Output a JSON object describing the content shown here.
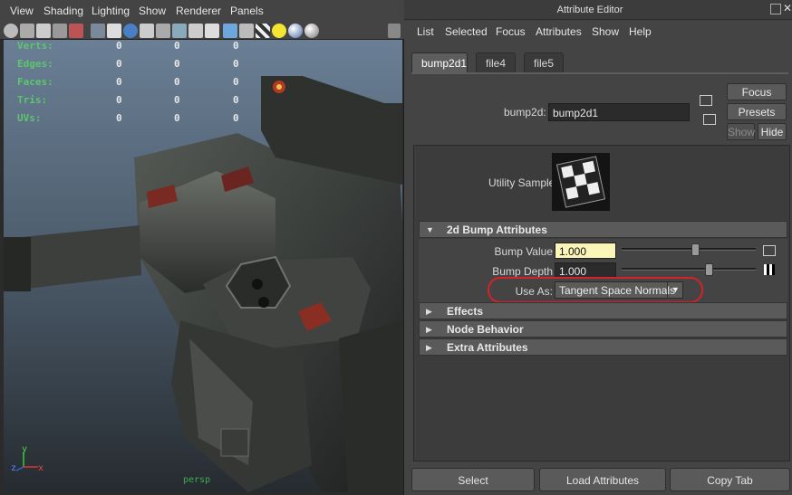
{
  "viewport": {
    "menu": [
      "View",
      "Shading",
      "Lighting",
      "Show",
      "Renderer",
      "Panels"
    ],
    "toolbar_icons": [
      "camera-icon",
      "camera-attributes-icon",
      "bookmark-icon",
      "image-plane-icon",
      "grid-icon",
      "wireframe-icon",
      "smooth-shade-icon",
      "textured-icon",
      "lights-icon",
      "shadows-icon",
      "xray-icon",
      "isolate-icon",
      "cube-wire-icon",
      "cube-shaded-icon",
      "cube-textured-icon",
      "checker-icon",
      "light-bulb-icon",
      "sphere-icon",
      "sphere-gray-icon",
      "resolution-gate-icon"
    ],
    "hud": [
      {
        "label": "Verts:",
        "values": [
          "0",
          "0",
          "0"
        ]
      },
      {
        "label": "Edges:",
        "values": [
          "0",
          "0",
          "0"
        ]
      },
      {
        "label": "Faces:",
        "values": [
          "0",
          "0",
          "0"
        ]
      },
      {
        "label": "Tris:",
        "values": [
          "0",
          "0",
          "0"
        ]
      },
      {
        "label": "UVs:",
        "values": [
          "0",
          "0",
          "0"
        ]
      }
    ],
    "camera": "persp",
    "axis_labels": {
      "x": "x",
      "y": "y",
      "z": "z"
    }
  },
  "attribute_editor": {
    "title": "Attribute Editor",
    "menu": [
      "List",
      "Selected",
      "Focus",
      "Attributes",
      "Show",
      "Help"
    ],
    "tabs": [
      {
        "label": "bump2d1",
        "active": true
      },
      {
        "label": "file4",
        "active": false
      },
      {
        "label": "file5",
        "active": false
      }
    ],
    "node_type_label": "bump2d:",
    "node_name": "bump2d1",
    "buttons": {
      "focus": "Focus",
      "presets": "Presets",
      "show": "Show",
      "hide": "Hide"
    },
    "utility_sample_label": "Utility Sample",
    "sections": [
      {
        "title": "2d Bump Attributes",
        "expanded": true
      },
      {
        "title": "Effects",
        "expanded": false
      },
      {
        "title": "Node Behavior",
        "expanded": false
      },
      {
        "title": "Extra Attributes",
        "expanded": false
      }
    ],
    "bump_value": {
      "label": "Bump Value",
      "value": "1.000",
      "slider_fraction": 0.55
    },
    "bump_depth": {
      "label": "Bump Depth",
      "value": "1.000",
      "slider_fraction": 0.65
    },
    "use_as": {
      "label": "Use As:",
      "value": "Tangent Space Normals"
    },
    "bottom_buttons": [
      "Select",
      "Load Attributes",
      "Copy Tab"
    ],
    "colors": {
      "highlight_ring": "#d8202a",
      "bump_value_field": "#fbf5b8",
      "bump_depth_field": "#2b2b2b"
    }
  }
}
